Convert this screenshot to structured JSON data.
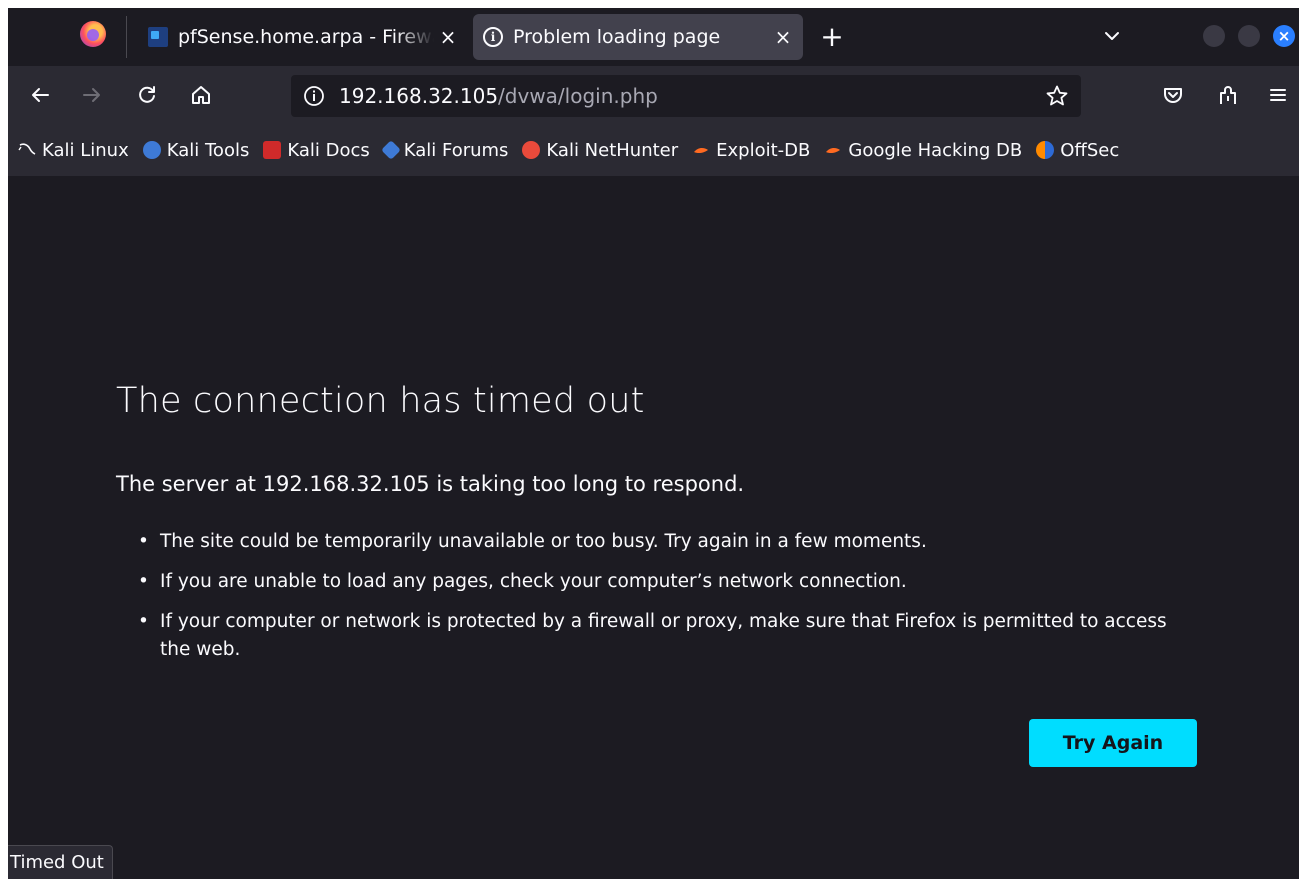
{
  "tabs": {
    "items": [
      {
        "label": "pfSense.home.arpa - Firewall: Rules"
      },
      {
        "label": "Problem loading page"
      }
    ],
    "close_glyph": "×",
    "new_tab_glyph": "+"
  },
  "toolbar": {
    "url_host": "192.168.32.105",
    "url_path": "/dvwa/login.php"
  },
  "bookmarks": [
    {
      "label": "Kali Linux",
      "icon": "kali-dragon-icon"
    },
    {
      "label": "Kali Tools",
      "icon": "kali-tools-icon"
    },
    {
      "label": "Kali Docs",
      "icon": "kali-docs-icon"
    },
    {
      "label": "Kali Forums",
      "icon": "kali-forums-icon"
    },
    {
      "label": "Kali NetHunter",
      "icon": "kali-nethunter-icon"
    },
    {
      "label": "Exploit-DB",
      "icon": "exploit-db-icon"
    },
    {
      "label": "Google Hacking DB",
      "icon": "ghdb-icon"
    },
    {
      "label": "OffSec",
      "icon": "offsec-icon"
    }
  ],
  "error": {
    "title": "The connection has timed out",
    "lead": "The server at 192.168.32.105 is taking too long to respond.",
    "bullets": [
      "The site could be temporarily unavailable or too busy. Try again in a few moments.",
      "If you are unable to load any pages, check your computer’s network connection.",
      "If your computer or network is protected by a firewall or proxy, make sure that Firefox is permitted to access the web."
    ],
    "button_label": "Try Again"
  },
  "status_text": "Timed Out",
  "colors": {
    "accent": "#00ddff",
    "page_bg": "#1c1b22",
    "toolbar_bg": "#2b2a33",
    "text": "#fbfbfe"
  }
}
